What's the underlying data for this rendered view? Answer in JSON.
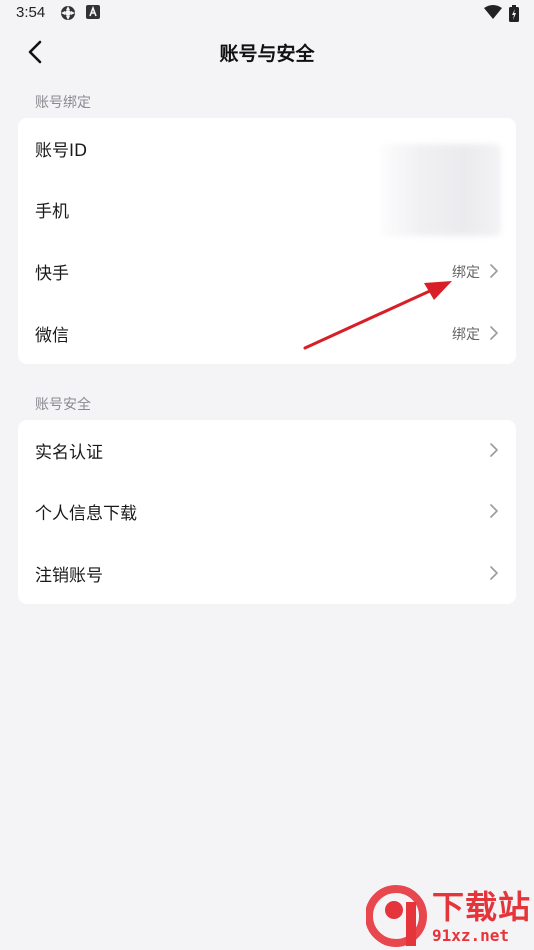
{
  "status_bar": {
    "time": "3:54"
  },
  "header": {
    "title": "账号与安全"
  },
  "binding_section": {
    "title": "账号绑定",
    "rows": [
      {
        "label": "账号ID",
        "value": ""
      },
      {
        "label": "手机",
        "value": ""
      },
      {
        "label": "快手",
        "value": "绑定"
      },
      {
        "label": "微信",
        "value": "绑定"
      }
    ]
  },
  "security_section": {
    "title": "账号安全",
    "rows": [
      {
        "label": "实名认证"
      },
      {
        "label": "个人信息下载"
      },
      {
        "label": "注销账号"
      }
    ]
  },
  "watermark": {
    "brand": "下载站",
    "url": "91xz.net",
    "logo_mark": "9"
  },
  "colors": {
    "background": "#f4f4f7",
    "card": "#ffffff",
    "annotation": "#d81e26",
    "watermark": "#e5343a"
  }
}
